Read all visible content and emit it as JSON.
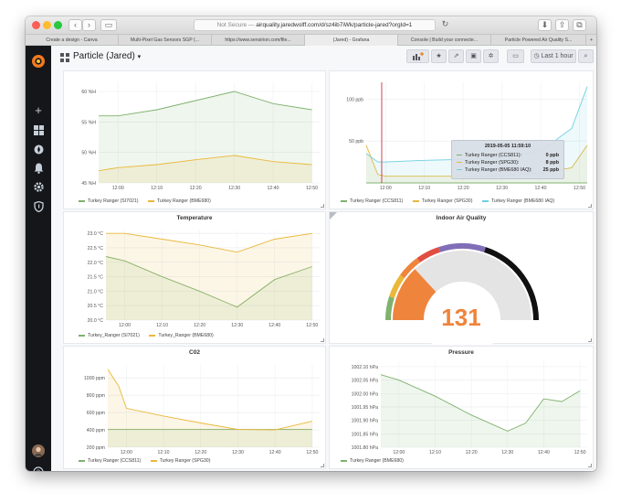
{
  "browser": {
    "url_prefix": "Not Secure — ",
    "url": "airquality.jaredwolff.com/d/sz4ib7iWk/particle-jared?orgId=1",
    "tabs": [
      "Create a design - Canva",
      "Multi-Pixel Gas Sensors SGP (...",
      "https://www.sensirion.com/file...",
      "(Jared) - Grafana",
      "Console | Build your connecte...",
      "Particle Powered Air Quality S..."
    ],
    "new_tab": "+"
  },
  "nav": {
    "title": "Particle (Jared)",
    "caret": "▾",
    "time_range": "Last 1 hour"
  },
  "colors": {
    "green": "#7eb26d",
    "yellow": "#eab839",
    "blue": "#6ed0e0",
    "orange": "#ef843c",
    "red": "#e24d42",
    "purple": "#806eb7",
    "black": "#111111"
  },
  "panels": {
    "humidity": {
      "title": "",
      "legend": [
        "Turkey Ranger (SI7021)",
        "Turkey Ranger (BME680)"
      ]
    },
    "gas": {
      "title": "",
      "legend": [
        "Turkey Ranger (CCS811)",
        "Turkey Ranger (SPG30)",
        "Turkey Ranger (BME680 IAQ)"
      ],
      "tooltip": {
        "time": "2019-05-05 11:59:10",
        "rows": [
          {
            "label": "Turkey Ranger (CCS811):",
            "value": "0 ppb"
          },
          {
            "label": "Turkey Ranger (SPG30):",
            "value": "8 ppb"
          },
          {
            "label": "Turkey Ranger (BME680 IAQ):",
            "value": "25 ppb"
          }
        ]
      }
    },
    "temperature": {
      "title": "Temperature",
      "legend": [
        "Turkey_Ranger (SI7021)",
        "Turkey_Ranger (BME680)"
      ]
    },
    "iaq": {
      "title": "Indoor Air Quality",
      "value": "131",
      "value_numeric": 131
    },
    "co2": {
      "title": "C02",
      "legend": [
        "Turkey Ranger (CCS811)",
        "Turkey Ranger (SPG30)"
      ]
    },
    "pressure": {
      "title": "Pressure",
      "legend": [
        "Turkey Ranger (BME680)"
      ]
    }
  },
  "chart_data": [
    {
      "type": "line",
      "title": "",
      "x": [
        "11:55",
        "12:00",
        "12:10",
        "12:20",
        "12:30",
        "12:40",
        "12:50"
      ],
      "x_ticks": [
        "12:00",
        "12:10",
        "12:20",
        "12:30",
        "12:40",
        "12:50"
      ],
      "y_ticks": [
        "45 %H",
        "50 %H",
        "55 %H",
        "60 %H"
      ],
      "ylim": [
        45,
        61.5
      ],
      "series": [
        {
          "name": "Turkey Ranger (SI7021)",
          "color": "#7eb26d",
          "values": [
            56,
            56,
            57,
            58.5,
            60,
            58,
            57
          ]
        },
        {
          "name": "Turkey Ranger (BME680)",
          "color": "#eab839",
          "values": [
            47,
            47.5,
            48,
            48.8,
            49.5,
            48.5,
            48
          ]
        }
      ]
    },
    {
      "type": "line",
      "title": "",
      "x": [
        "11:55",
        "11:58",
        "12:00",
        "12:10",
        "12:20",
        "12:30",
        "12:40",
        "12:48",
        "12:52"
      ],
      "x_ticks": [
        "12:00",
        "12:10",
        "12:20",
        "12:30",
        "12:40",
        "12:50"
      ],
      "y_ticks": [
        "50 ppb",
        "100 ppb"
      ],
      "ylim": [
        0,
        120
      ],
      "series": [
        {
          "name": "Turkey Ranger (CCS811)",
          "color": "#7eb26d",
          "values": [
            0,
            0,
            0,
            0,
            0,
            0,
            0,
            0,
            0
          ]
        },
        {
          "name": "Turkey Ranger (SPG30)",
          "color": "#eab839",
          "values": [
            45,
            10,
            8,
            8,
            8,
            9,
            12,
            18,
            45
          ]
        },
        {
          "name": "Turkey Ranger (BME680 IAQ)",
          "color": "#6ed0e0",
          "values": [
            35,
            25,
            25,
            27,
            28,
            30,
            38,
            65,
            115
          ]
        }
      ]
    },
    {
      "type": "line",
      "title": "Temperature",
      "x": [
        "11:55",
        "12:00",
        "12:10",
        "12:20",
        "12:30",
        "12:40",
        "12:50"
      ],
      "x_ticks": [
        "12:00",
        "12:10",
        "12:20",
        "12:30",
        "12:40",
        "12:50"
      ],
      "y_ticks": [
        "20.0 °C",
        "20.5 °C",
        "21.0 °C",
        "21.5 °C",
        "22.0 °C",
        "22.5 °C",
        "23.0 °C"
      ],
      "ylim": [
        20,
        23.1
      ],
      "series": [
        {
          "name": "Turkey_Ranger (SI7021)",
          "color": "#7eb26d",
          "values": [
            22.2,
            22.05,
            21.5,
            21.0,
            20.45,
            21.4,
            21.85
          ]
        },
        {
          "name": "Turkey_Ranger (BME680)",
          "color": "#eab839",
          "values": [
            23.0,
            23.0,
            22.8,
            22.6,
            22.35,
            22.8,
            23.0
          ]
        }
      ]
    },
    {
      "type": "line",
      "title": "C02",
      "x": [
        "11:55",
        "11:58",
        "12:00",
        "12:10",
        "12:20",
        "12:30",
        "12:40",
        "12:50"
      ],
      "x_ticks": [
        "12:00",
        "12:10",
        "12:20",
        "12:30",
        "12:40",
        "12:50"
      ],
      "y_ticks": [
        "200 ppm",
        "400 ppm",
        "600 ppm",
        "800 ppm",
        "1000 ppm"
      ],
      "ylim": [
        200,
        1150
      ],
      "series": [
        {
          "name": "Turkey Ranger (CCS811)",
          "color": "#7eb26d",
          "values": [
            405,
            405,
            405,
            405,
            405,
            405,
            405,
            405
          ]
        },
        {
          "name": "Turkey Ranger (SPG30)",
          "color": "#eab839",
          "values": [
            1100,
            900,
            650,
            560,
            480,
            405,
            400,
            500
          ]
        }
      ]
    },
    {
      "type": "line",
      "title": "Pressure",
      "x": [
        "11:55",
        "12:00",
        "12:10",
        "12:20",
        "12:30",
        "12:35",
        "12:40",
        "12:45",
        "12:50"
      ],
      "x_ticks": [
        "12:00",
        "12:10",
        "12:20",
        "12:30",
        "12:40",
        "12:50"
      ],
      "y_ticks": [
        "1001.80 hPa",
        "1001.85 hPa",
        "1001.90 hPa",
        "1001.95 hPa",
        "1002.00 hPa",
        "1002.05 hPa",
        "1002.10 hPa"
      ],
      "ylim": [
        1001.8,
        1002.12
      ],
      "series": [
        {
          "name": "Turkey Ranger (BME680)",
          "color": "#7eb26d",
          "values": [
            1002.07,
            1002.05,
            1001.99,
            1001.92,
            1001.86,
            1001.89,
            1001.98,
            1001.97,
            1002.01
          ]
        }
      ]
    }
  ]
}
